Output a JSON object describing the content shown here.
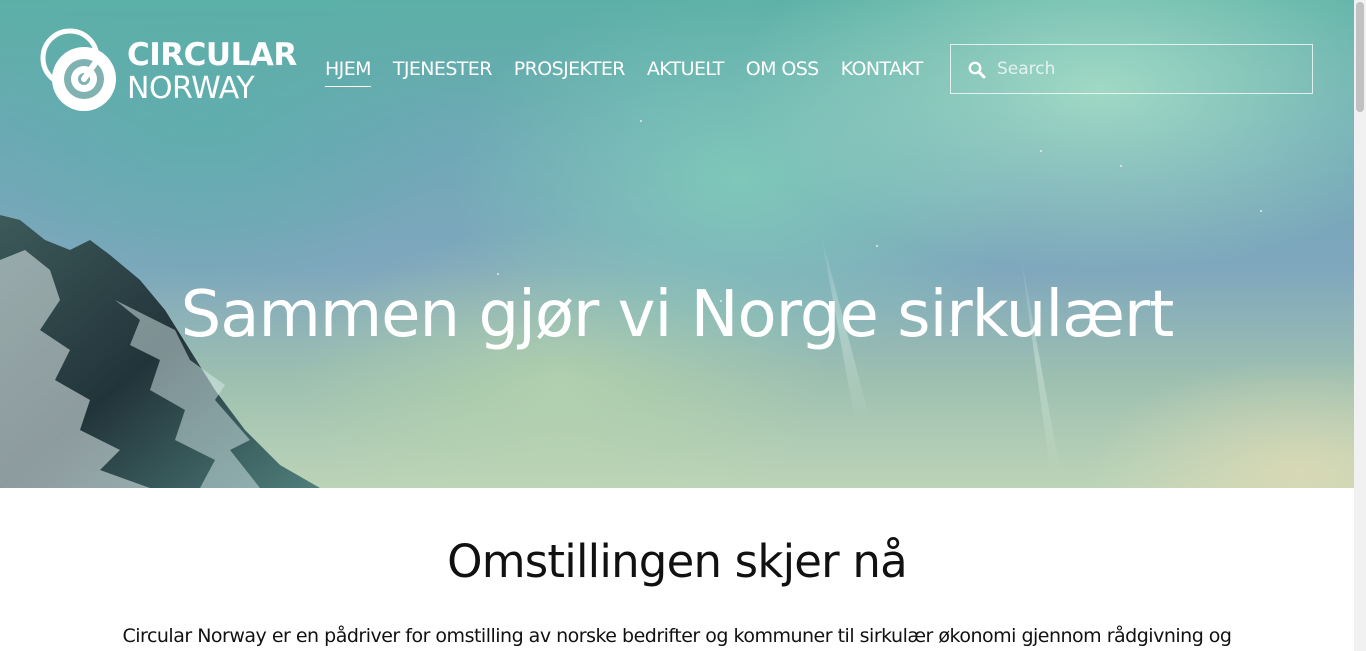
{
  "brand": {
    "name_line1": "CIRCULAR",
    "name_line2": "NORWAY",
    "logo_icon": "circular-rings-icon"
  },
  "nav": {
    "items": [
      {
        "label": "HJEM",
        "active": true
      },
      {
        "label": "TJENESTER",
        "active": false
      },
      {
        "label": "PROSJEKTER",
        "active": false
      },
      {
        "label": "AKTUELT",
        "active": false
      },
      {
        "label": "OM OSS",
        "active": false
      },
      {
        "label": "KONTAKT",
        "active": false
      }
    ]
  },
  "search": {
    "placeholder": "Search",
    "value": "",
    "icon": "search-icon"
  },
  "hero": {
    "title": "Sammen gjør vi Norge sirkulært"
  },
  "content": {
    "heading": "Omstillingen skjer nå",
    "intro": "Circular Norway er en pådriver for omstilling av norske bedrifter og kommuner til sirkulær økonomi gjennom rådgivning og"
  },
  "colors": {
    "text_light": "#ffffff",
    "text_dark": "#111111",
    "page_background": "#ffffff"
  }
}
